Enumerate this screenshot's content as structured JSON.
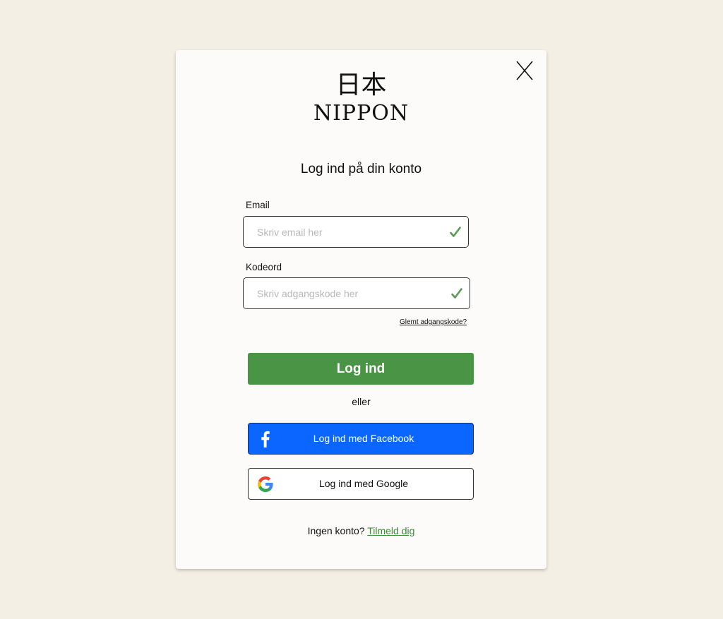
{
  "logo": {
    "kanji": "日本",
    "name": "NIPPON"
  },
  "dialog": {
    "close_icon": "close-icon",
    "title": "Log ind på din konto"
  },
  "form": {
    "email": {
      "label": "Email",
      "placeholder": "Skriv email her",
      "value": "",
      "status_icon": "check-icon"
    },
    "password": {
      "label": "Kodeord",
      "placeholder": "Skriv adgangskode her",
      "value": "",
      "status_icon": "check-icon"
    },
    "forgot_label": "Glemt adgangskode?",
    "submit_label": "Log ind"
  },
  "divider_text": "eller",
  "social": {
    "facebook": {
      "label": "Log ind med Facebook",
      "icon": "facebook-icon"
    },
    "google": {
      "label": "Log ind med Google",
      "icon": "google-icon"
    }
  },
  "signup": {
    "prompt": "Ingen konto?",
    "link_label": "Tilmeld dig"
  },
  "colors": {
    "page_background": "#f3efe5",
    "card_background": "#fcfbf9",
    "primary_green": "#4a9446",
    "facebook_blue": "#0a66ff",
    "check_green": "#5a9a55",
    "link_green": "#3a8a3a"
  }
}
